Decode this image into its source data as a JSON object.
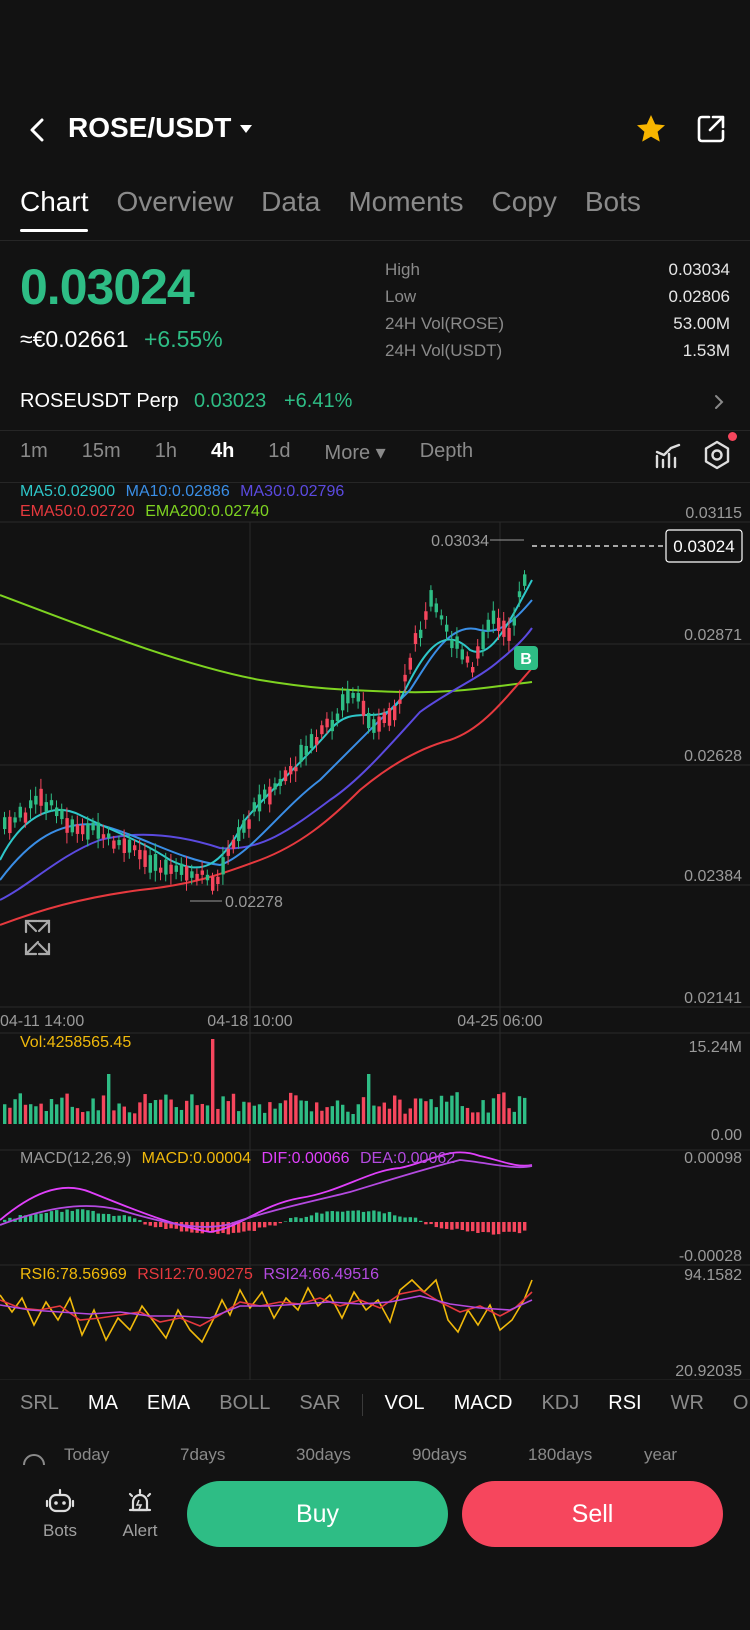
{
  "header": {
    "pair": "ROSE/USDT"
  },
  "tabs": [
    "Chart",
    "Overview",
    "Data",
    "Moments",
    "Copy",
    "Bots"
  ],
  "price": {
    "last": "0.03024",
    "fiat": "≈€0.02661",
    "change": "+6.55%"
  },
  "stats": [
    {
      "label": "High",
      "value": "0.03034"
    },
    {
      "label": "Low",
      "value": "0.02806"
    },
    {
      "label": "24H Vol(ROSE)",
      "value": "53.00M"
    },
    {
      "label": "24H Vol(USDT)",
      "value": "1.53M"
    }
  ],
  "perp": {
    "name": "ROSEUSDT Perp",
    "price": "0.03023",
    "change": "+6.41%"
  },
  "intervals": [
    "1m",
    "15m",
    "1h",
    "4h",
    "1d",
    "More ▾",
    "Depth"
  ],
  "active_interval": "4h",
  "indicators": {
    "ma5": "MA5:0.02900",
    "ma10": "MA10:0.02886",
    "ma30": "MA30:0.02796",
    "ema50": "EMA50:0.02720",
    "ema200": "EMA200:0.02740",
    "vol": "Vol:4258565.45",
    "macd_title": "MACD(12,26,9)",
    "macd": "MACD:0.00004",
    "dif": "DIF:0.00066",
    "dea": "DEA:0.00062",
    "rsi6": "RSI6:78.56969",
    "rsi12": "RSI12:70.90275",
    "rsi24": "RSI24:66.49516"
  },
  "colors": {
    "up": "#2ebd85",
    "down": "#f6465d",
    "ma5": "#2ec7c9",
    "ma10": "#3a8ee6",
    "ma30": "#5b4ae0",
    "ema50": "#e6393e",
    "ema200": "#7ed321",
    "macd": "#f0b90b",
    "dif": "#e040fb",
    "dea": "#b44ae0",
    "star": "#f7b500"
  },
  "chart_data": {
    "type": "candlestick",
    "y_axis_ticks": [
      "0.03115",
      "0.02871",
      "0.02628",
      "0.02384",
      "0.02141"
    ],
    "ylim": [
      0.02141,
      0.03115
    ],
    "x_axis_ticks": [
      "04-11 14:00",
      "04-18 10:00",
      "04-25 06:00"
    ],
    "high_marker": "0.03034",
    "low_marker": "0.02278",
    "current_price_tag": "0.03024",
    "trade_marker": "B",
    "volume_axis": [
      "15.24M",
      "0.00"
    ],
    "macd_axis": [
      "0.00098",
      "-0.00028"
    ],
    "rsi_axis": [
      "94.1582",
      "20.92035"
    ]
  },
  "indicator_tabs": [
    "SRL",
    "MA",
    "EMA",
    "BOLL",
    "SAR",
    "VOL",
    "MACD",
    "KDJ",
    "RSI",
    "WR",
    "OB"
  ],
  "indicator_tabs_on": [
    "MA",
    "EMA",
    "VOL",
    "MACD",
    "RSI"
  ],
  "ranges": [
    "Today",
    "7days",
    "30days",
    "90days",
    "180days",
    "year"
  ],
  "bottom": {
    "bots": "Bots",
    "alert": "Alert",
    "buy": "Buy",
    "sell": "Sell"
  }
}
